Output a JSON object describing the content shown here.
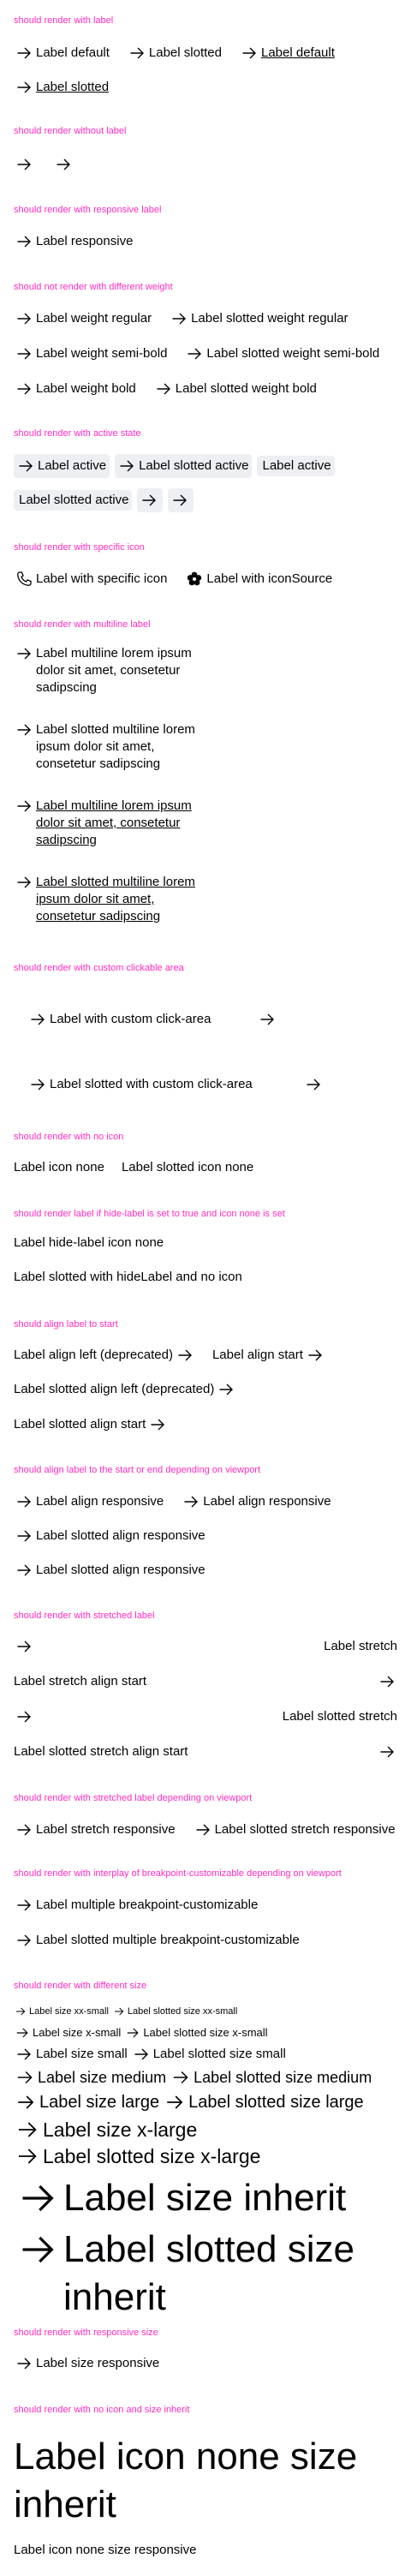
{
  "sections": {
    "label": {
      "heading": "should render with label",
      "items": [
        "Label default",
        "Label slotted",
        "Label default",
        "Label slotted"
      ]
    },
    "without_label": {
      "heading": "should render without label"
    },
    "responsive_label": {
      "heading": "should render with responsive label",
      "item": "Label responsive"
    },
    "weight": {
      "heading": "should not render with different weight",
      "items": [
        "Label weight regular",
        "Label slotted weight regular",
        "Label weight semi-bold",
        "Label slotted weight semi-bold",
        "Label weight bold",
        "Label slotted weight bold"
      ]
    },
    "active": {
      "heading": "should render with active state",
      "items": [
        "Label active",
        "Label slotted active",
        "Label active",
        "Label slotted active"
      ]
    },
    "specific_icon": {
      "heading": "should render with specific icon",
      "items": [
        "Label with specific icon",
        "Label with iconSource"
      ]
    },
    "multiline": {
      "heading": "should render with multiline label",
      "items": [
        "Label multiline lorem ipsum dolor sit amet, consetetur sadipscing",
        "Label slotted multiline lorem ipsum dolor sit amet, consetetur sadipscing",
        "Label multiline lorem ipsum dolor sit amet, consetetur sadipscing",
        "Label slotted multiline lorem ipsum dolor sit amet, consetetur sadipscing"
      ]
    },
    "clickable_area": {
      "heading": "should render with custom clickable area",
      "items": [
        "Label with custom click-area",
        "Label slotted with custom click-area"
      ]
    },
    "no_icon": {
      "heading": "should render with no icon",
      "items": [
        "Label icon none",
        "Label slotted icon none"
      ]
    },
    "hide_label_no_icon": {
      "heading": "should render label if hide-label is set to true and icon none is set",
      "items": [
        "Label hide-label icon none",
        "Label slotted with hideLabel and no icon"
      ]
    },
    "align_start": {
      "heading": "should align label to start",
      "items": [
        "Label align left (deprecated)",
        "Label align start",
        "Label slotted align left (deprecated)",
        "Label slotted align start"
      ]
    },
    "align_viewport": {
      "heading": "should align label to the start or end depending on viewport",
      "items": [
        "Label align responsive",
        "Label align responsive",
        "Label slotted align responsive",
        "Label slotted align responsive"
      ]
    },
    "stretched": {
      "heading": "should render with stretched label",
      "items": [
        "Label stretch",
        "Label stretch align start",
        "Label slotted stretch",
        "Label slotted stretch align start"
      ]
    },
    "stretched_viewport": {
      "heading": "should render with stretched label depending on viewport",
      "items": [
        "Label stretch responsive",
        "Label slotted stretch responsive"
      ]
    },
    "breakpoint": {
      "heading": "should render with interplay of breakpoint-customizable depending on viewport",
      "items": [
        "Label multiple breakpoint-customizable",
        "Label slotted multiple breakpoint-customizable"
      ]
    },
    "size": {
      "heading": "should render with different size",
      "items": [
        "Label size xx-small",
        "Label slotted size xx-small",
        "Label size x-small",
        "Label slotted size x-small",
        "Label size small",
        "Label slotted size small",
        "Label size medium",
        "Label slotted size medium",
        "Label size large",
        "Label slotted size large",
        "Label size x-large",
        "Label slotted size x-large",
        "Label size inherit",
        "Label slotted size inherit"
      ]
    },
    "responsive_size": {
      "heading": "should render with responsive size",
      "item": "Label size responsive"
    },
    "no_icon_inherit": {
      "heading": "should render with no icon and size inherit",
      "items": [
        "Label icon none size inherit",
        "Label icon none size responsive"
      ]
    }
  },
  "icons": {
    "default": "arrow-right-icon",
    "specific": "phone-icon",
    "source": "flower-icon"
  },
  "colors": {
    "heading": "#ff2bbf",
    "text": "#010205",
    "active_bg": "#eeeff2"
  }
}
